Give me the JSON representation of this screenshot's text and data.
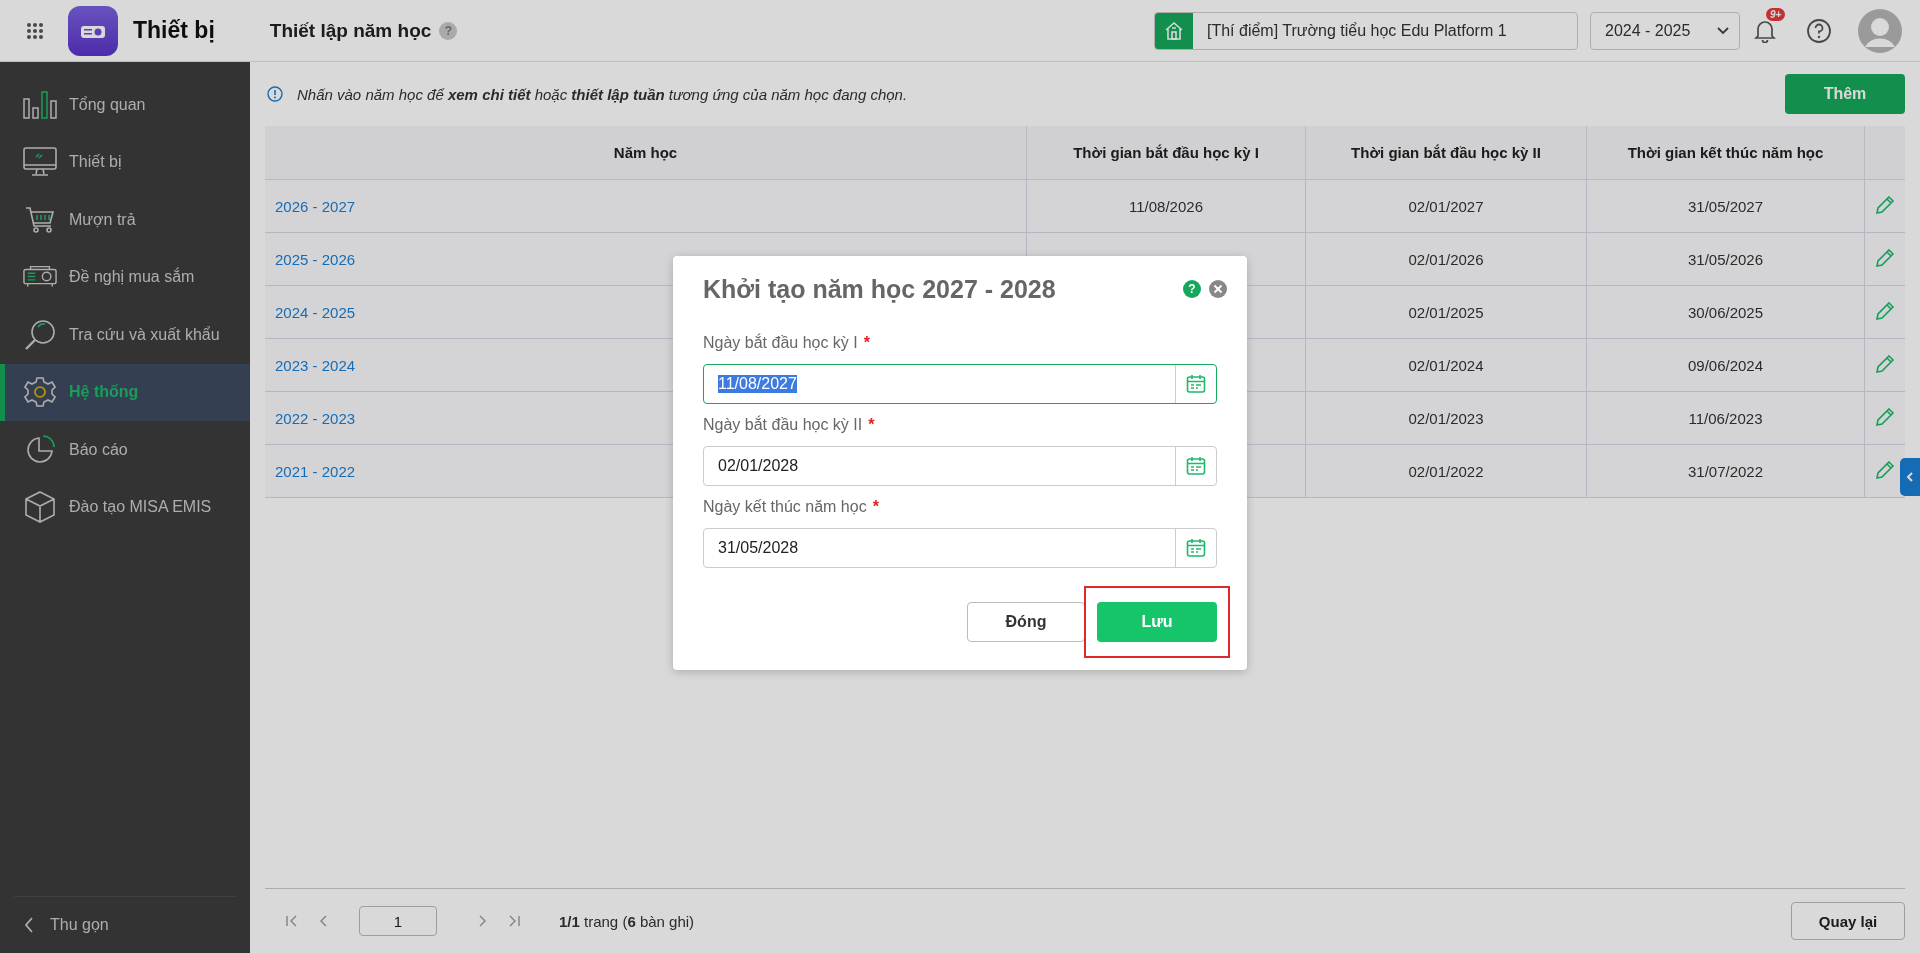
{
  "app": {
    "title": "Thiết bị"
  },
  "page": {
    "title": "Thiết lập năm học",
    "help": "?"
  },
  "school": "[Thí điểm] Trường tiểu học Edu Platform 1",
  "year_select": "2024 - 2025",
  "notifications": {
    "badge": "9+"
  },
  "sidebar": {
    "items": [
      {
        "label": "Tổng quan",
        "selected": false
      },
      {
        "label": "Thiết bị",
        "selected": false
      },
      {
        "label": "Mượn trả",
        "selected": false
      },
      {
        "label": "Đề nghị mua sắm",
        "selected": false
      },
      {
        "label": "Tra cứu và xuất khẩu",
        "selected": false
      },
      {
        "label": "Hệ thống",
        "selected": true
      },
      {
        "label": "Báo cáo",
        "selected": false
      },
      {
        "label": "Đào tạo MISA EMIS",
        "selected": false
      }
    ],
    "collapse": "Thu gọn"
  },
  "info": "Nhấn vào năm học để **xem chi tiết** hoặc **thiết lập tuần** tương ứng của năm học đang chọn.",
  "add_button": "Thêm",
  "table": {
    "columns": [
      "Năm học",
      "Thời gian bắt đầu học kỳ I",
      "Thời gian bắt đầu học kỳ II",
      "Thời gian kết thúc năm học"
    ],
    "rows": [
      {
        "year": "2026 - 2027",
        "start_1": "11/08/2026",
        "start_2": "02/01/2027",
        "end": "31/05/2027"
      },
      {
        "year": "2025 - 2026",
        "start_2": "02/01/2026",
        "end": "31/05/2026"
      },
      {
        "year": "2024 - 2025",
        "start_2": "02/01/2025",
        "end": "30/06/2025"
      },
      {
        "year": "2023 - 2024",
        "start_2": "02/01/2024",
        "end": "09/06/2024"
      },
      {
        "year": "2022 - 2023",
        "start_2": "02/01/2023",
        "end": "11/06/2023"
      },
      {
        "year": "2021 - 2022",
        "start_2": "02/01/2022",
        "end": "31/07/2022"
      }
    ]
  },
  "pagination": {
    "page": "1",
    "summary": "**1/1** trang (**6** bàn ghi)"
  },
  "back_button": "Quay lại",
  "dialog": {
    "title": "Khởi tạo năm học 2027 - 2028",
    "help": "?",
    "fields": [
      {
        "label": "Ngày bắt đầu học kỳ I",
        "mark": "*",
        "value": "11/08/2027",
        "focused": true
      },
      {
        "label": "Ngày bắt đầu học kỳ II",
        "mark": "*",
        "value": "02/01/2028",
        "focused": false
      },
      {
        "label": "Ngày kết thúc năm học",
        "mark": "*",
        "value": "31/05/2028",
        "focused": false
      }
    ],
    "close_button": "Đóng",
    "save_button": "Lưu",
    "save_highlighted": true
  }
}
